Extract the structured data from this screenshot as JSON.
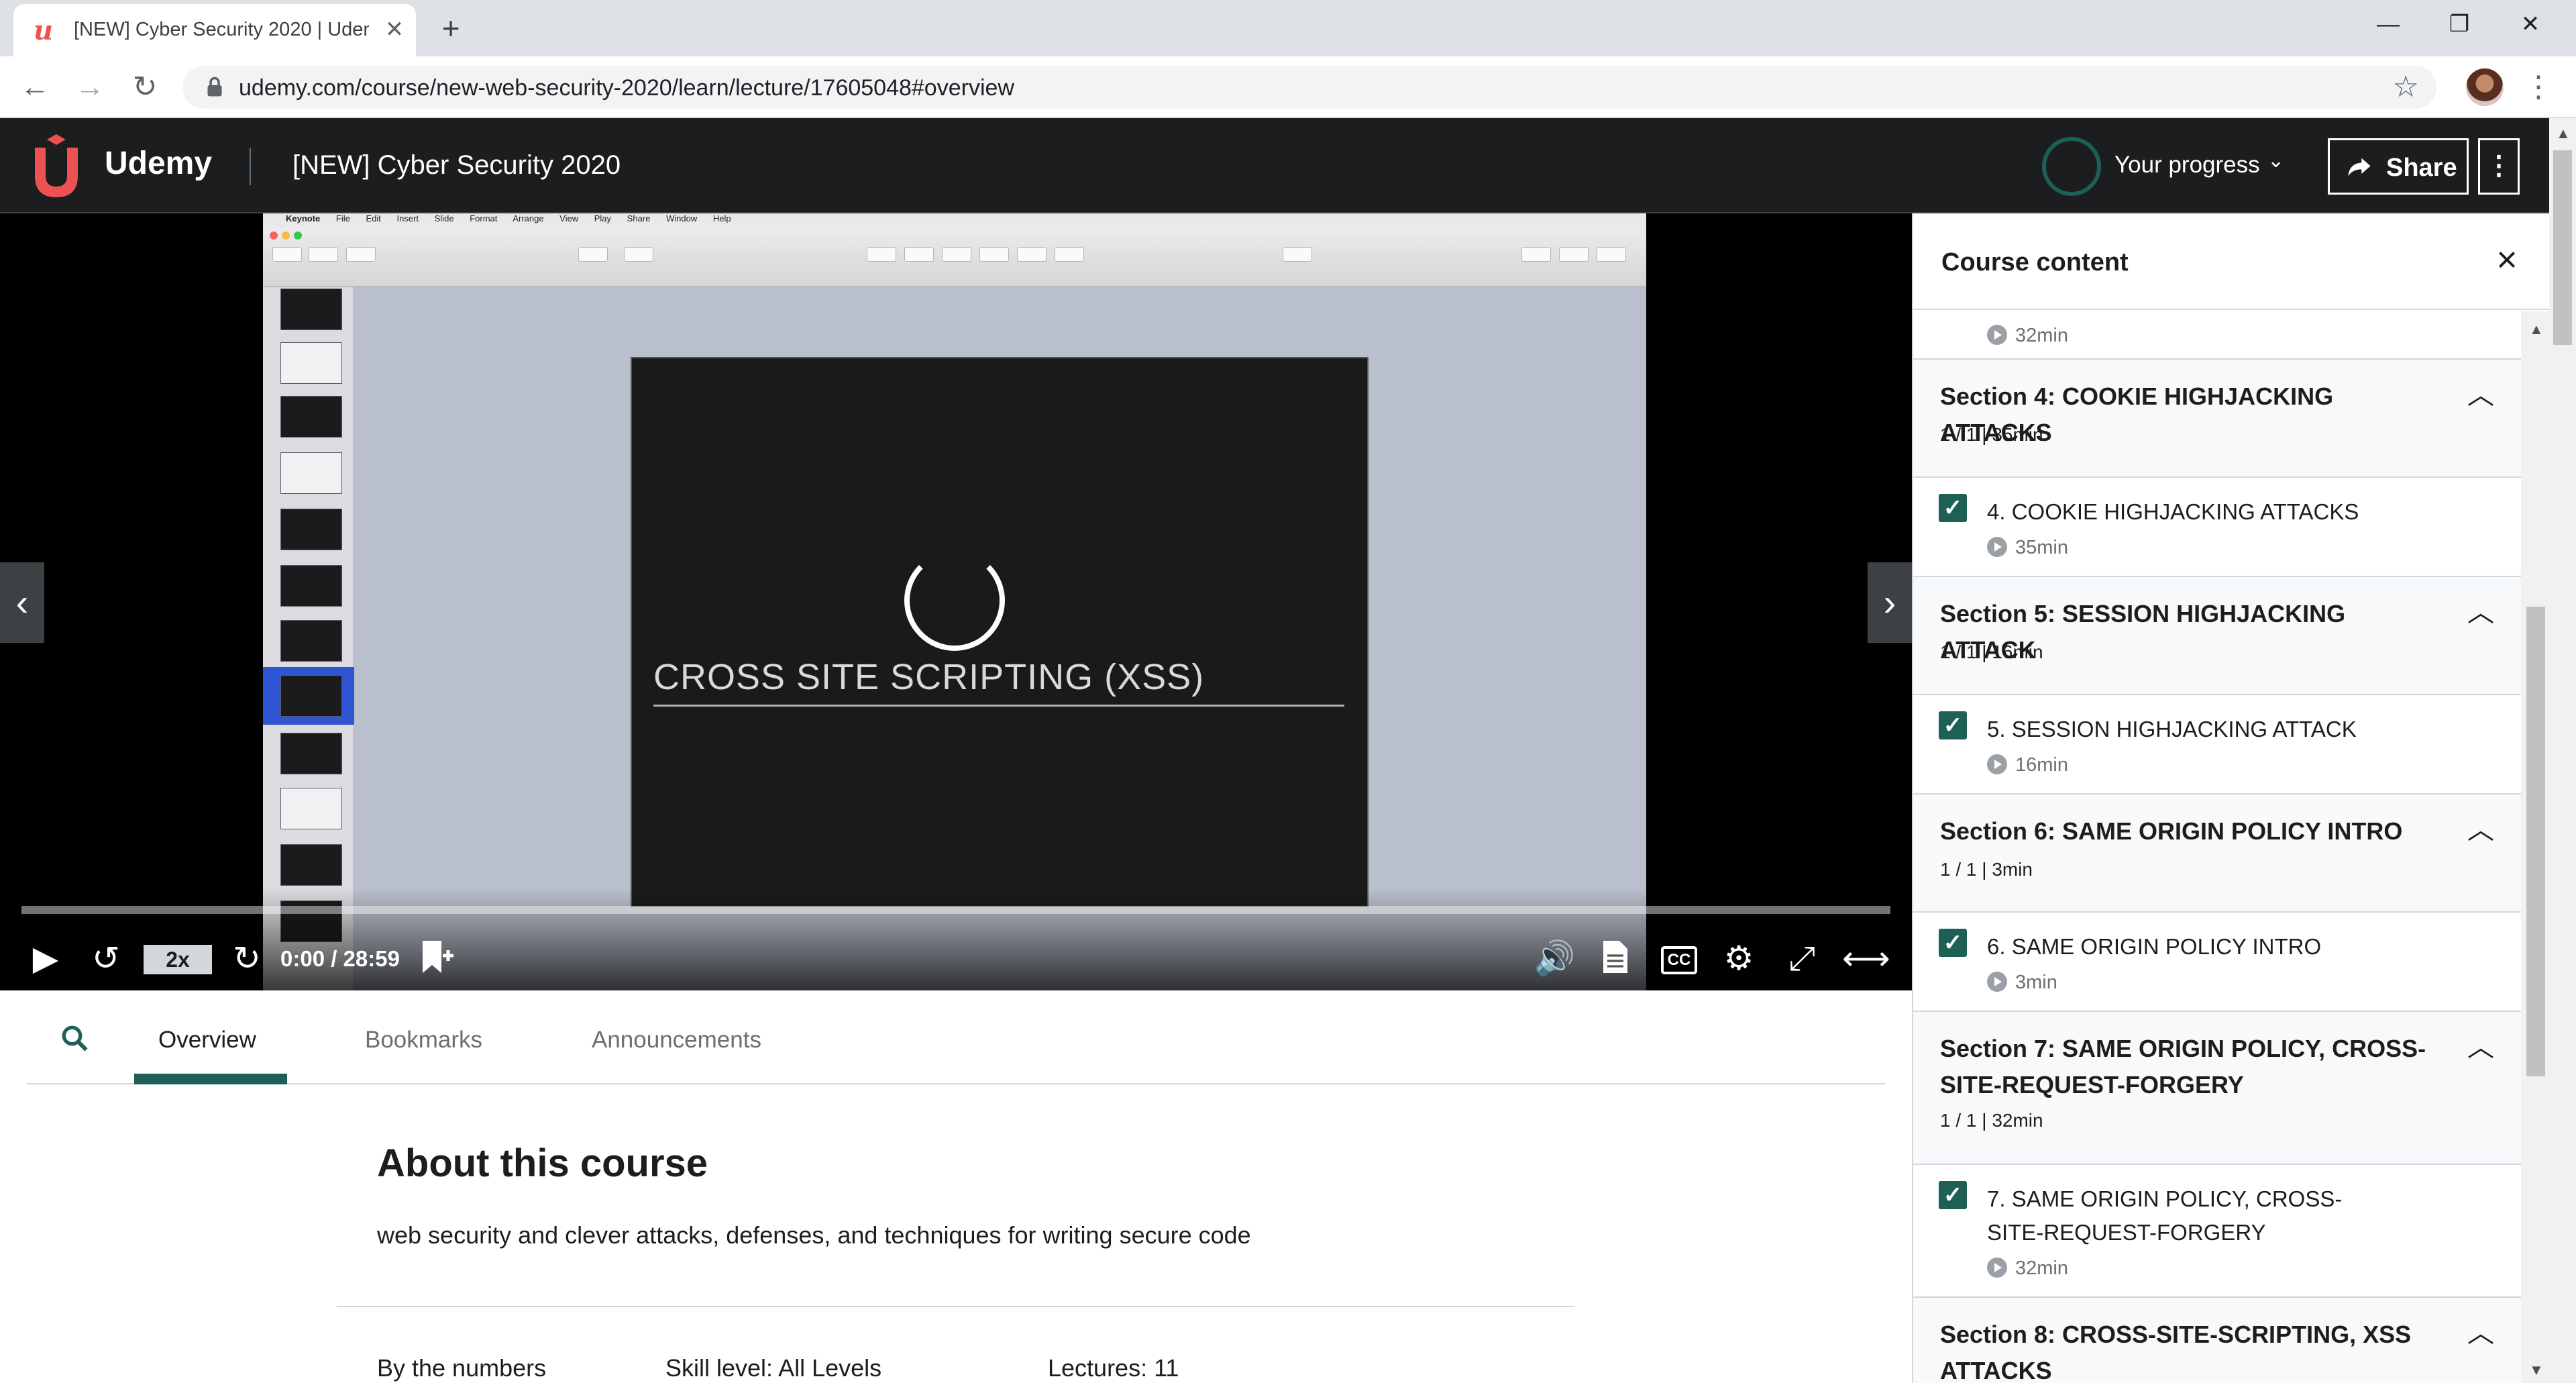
{
  "browser": {
    "tab_title": "[NEW] Cyber Security 2020 | Udemy",
    "url": "udemy.com/course/new-web-security-2020/learn/lecture/17605048#overview"
  },
  "header": {
    "logo_text": "Udemy",
    "course_title": "[NEW] Cyber Security 2020",
    "progress_label": "Your progress",
    "share_label": "Share",
    "brand_color": "#ec5252",
    "accent_color": "#1e6055"
  },
  "player": {
    "slide_title": "CROSS SITE SCRIPTING (XSS)",
    "speed": "2x",
    "time": "0:00 / 28:59",
    "cc_label": "CC",
    "mac_menu": [
      "Keynote",
      "File",
      "Edit",
      "Insert",
      "Slide",
      "Format",
      "Arrange",
      "View",
      "Play",
      "Share",
      "Window",
      "Help"
    ]
  },
  "tabs": {
    "overview": "Overview",
    "bookmarks": "Bookmarks",
    "announcements": "Announcements"
  },
  "about": {
    "title": "About this course",
    "description": "web security and clever attacks, defenses, and techniques for writing secure code",
    "by_numbers": "By the numbers",
    "skill_level": "Skill level: All Levels",
    "lectures": "Lectures: 11"
  },
  "sidebar": {
    "title": "Course content",
    "prev_duration": "32min",
    "sections": [
      {
        "title": "Section 4: COOKIE HIGHJACKING ATTACKS",
        "meta": "1 / 1 | 35min",
        "lecture": "4. COOKIE HIGHJACKING ATTACKS",
        "duration": "35min"
      },
      {
        "title": "Section 5: SESSION HIGHJACKING ATTACK",
        "meta": "1 / 1 | 16min",
        "lecture": "5. SESSION HIGHJACKING ATTACK",
        "duration": "16min"
      },
      {
        "title": "Section 6: SAME ORIGIN POLICY INTRO",
        "meta": "1 / 1 | 3min",
        "lecture": "6. SAME ORIGIN POLICY INTRO",
        "duration": "3min"
      },
      {
        "title": "Section 7: SAME ORIGIN POLICY, CROSS-SITE-REQUEST-FORGERY",
        "meta": "1 / 1 | 32min",
        "lecture": "7. SAME ORIGIN POLICY, CROSS-SITE-REQUEST-FORGERY",
        "duration": "32min"
      },
      {
        "title": "Section 8: CROSS-SITE-SCRIPTING, XSS ATTACKS"
      }
    ]
  }
}
